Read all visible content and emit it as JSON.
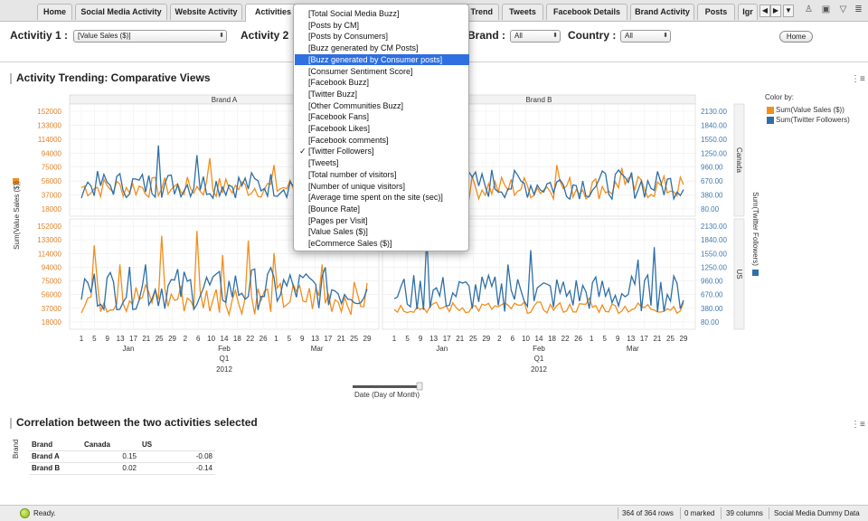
{
  "tabs": [
    "Home",
    "Social Media Activity",
    "Website Activity",
    "Activities C",
    "Trend",
    "Tweets",
    "Facebook Details",
    "Brand Activity",
    "Posts",
    "Igr"
  ],
  "active_tab": "Activities C",
  "filters": {
    "activity1_label": "Activitiy 1 :",
    "activity1_value": "[Value Sales ($)]",
    "activity2_label": "Activity 2 :",
    "brand_label": "Brand :",
    "brand_value": "All",
    "country_label": "Country :",
    "country_value": "All",
    "home_button": "Home"
  },
  "dropdown": {
    "items": [
      "[Total Social Media Buzz]",
      "[Posts by CM]",
      "[Posts by Consumers]",
      "[Buzz generated by CM Posts]",
      "[Buzz generated by Consumer posts]",
      "[Consumer Sentiment Score]",
      "[Facebook Buzz]",
      "[Twitter Buzz]",
      "[Other Communities Buzz]",
      "[Facebook Fans]",
      "[Facebook Likes]",
      "[Facebook comments]",
      "[Twitter Followers]",
      "[Tweets]",
      "[Total number of visitors]",
      "[Number of unique visitors]",
      "[Average time spent on the site (sec)]",
      "[Bounce Rate]",
      "[Pages per Visit]",
      "[Value Sales ($)]",
      "[eCommerce Sales ($)]"
    ],
    "highlighted": "[Buzz generated by Consumer posts]",
    "checked": "[Twitter Followers]"
  },
  "section1_title": "Activity Trending: Comparative Views",
  "section2_title": "Correlation between the two activities selected",
  "legend": {
    "title": "Color by:",
    "items": [
      {
        "label": "Sum(Value Sales ($))",
        "color": "#f28e1c"
      },
      {
        "label": "Sum(Twitter Followers)",
        "color": "#2e6fa7"
      }
    ]
  },
  "chart_data": {
    "type": "line",
    "panels": [
      "Brand A",
      "Brand B"
    ],
    "rows": [
      "Canada",
      "US"
    ],
    "left_axis_label": "Sum(Value Sales ($))",
    "right_axis_label": "Sum(Twitter Followers)",
    "left_ticks": [
      "152000",
      "133000",
      "114000",
      "94000",
      "75000",
      "56000",
      "37000",
      "18000"
    ],
    "right_ticks": [
      "2130.00",
      "1840.00",
      "1550.00",
      "1250.00",
      "960.00",
      "670.00",
      "380.00",
      "80.00"
    ],
    "x_ticks": [
      "1",
      "5",
      "9",
      "13",
      "17",
      "21",
      "25",
      "29",
      "2",
      "6",
      "10",
      "14",
      "18",
      "22",
      "26",
      "1",
      "5",
      "9",
      "13",
      "17",
      "21",
      "25",
      "29"
    ],
    "x_ticks_brand_b": [
      "1",
      "5",
      "9",
      "13",
      "17",
      "21",
      "25",
      "29",
      "2",
      "6",
      "10",
      "14",
      "18",
      "22",
      "26",
      "1",
      "5",
      "9",
      "13",
      "17",
      "21",
      "25",
      "29"
    ],
    "months": [
      "Jan",
      "Feb",
      "Mar"
    ],
    "quarter": "Q1",
    "year": "2012",
    "xlabel": "Date (Day of Month)",
    "series": [
      {
        "name": "Sum(Value Sales ($))",
        "color": "#f28e1c"
      },
      {
        "name": "Sum(Twitter Followers)",
        "color": "#2e6fa7"
      }
    ]
  },
  "correlation": {
    "row_header": "Brand",
    "columns": [
      "Brand",
      "Canada",
      "US"
    ],
    "rows": [
      {
        "brand": "Brand A",
        "canada": "0.15",
        "us": "-0.08"
      },
      {
        "brand": "Brand B",
        "canada": "0.02",
        "us": "-0.14"
      }
    ]
  },
  "status": {
    "ready": "Ready.",
    "rows": "364 of 364 rows",
    "marked": "0 marked",
    "columns": "39 columns",
    "source": "Social Media Dummy Data"
  }
}
